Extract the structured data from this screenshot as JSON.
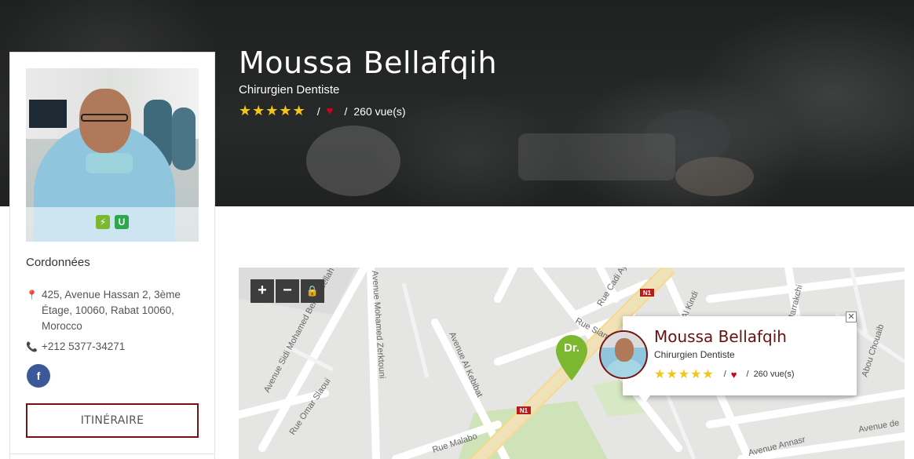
{
  "profile": {
    "name": "Moussa Bellafqih",
    "specialty": "Chirurgien Dentiste",
    "stars": "★★★★★",
    "rating_value": 5,
    "separator": "/",
    "views": "260 vue(s)"
  },
  "badges": {
    "flash_icon": "⚡",
    "shield_icon": "U"
  },
  "contact": {
    "section_title": "Cordonnées",
    "address": "425, Avenue Hassan 2, 3ème Étage, 10060, Rabat 10060, Morocco",
    "phone": "+212 5377-34271",
    "facebook_label": "f",
    "itinerary_button": "ITINÉRAIRE"
  },
  "map": {
    "zoom_in": "+",
    "zoom_out": "−",
    "lock_icon": "🔒",
    "marker_label": "Dr.",
    "popup_close": "✕",
    "road_badge": "N1",
    "streets": [
      "Avenue Sidi Mohamed Ben Abdellah",
      "Avenue Mohamed Zerktouni",
      "Avenue Al Kebibat",
      "Rue Omar Slaoui",
      "Rue Cadi Ayad",
      "Rue Siam",
      "Al Kindi",
      "Rue Malabo",
      "Avenue Annasr",
      "Abou Chouaib",
      "Marrakchi",
      "Avenue de"
    ]
  },
  "colors": {
    "accent": "#7a1212",
    "stars": "#f5c518",
    "heart": "#d0021b",
    "facebook": "#3b5998",
    "marker": "#7cb82f"
  }
}
